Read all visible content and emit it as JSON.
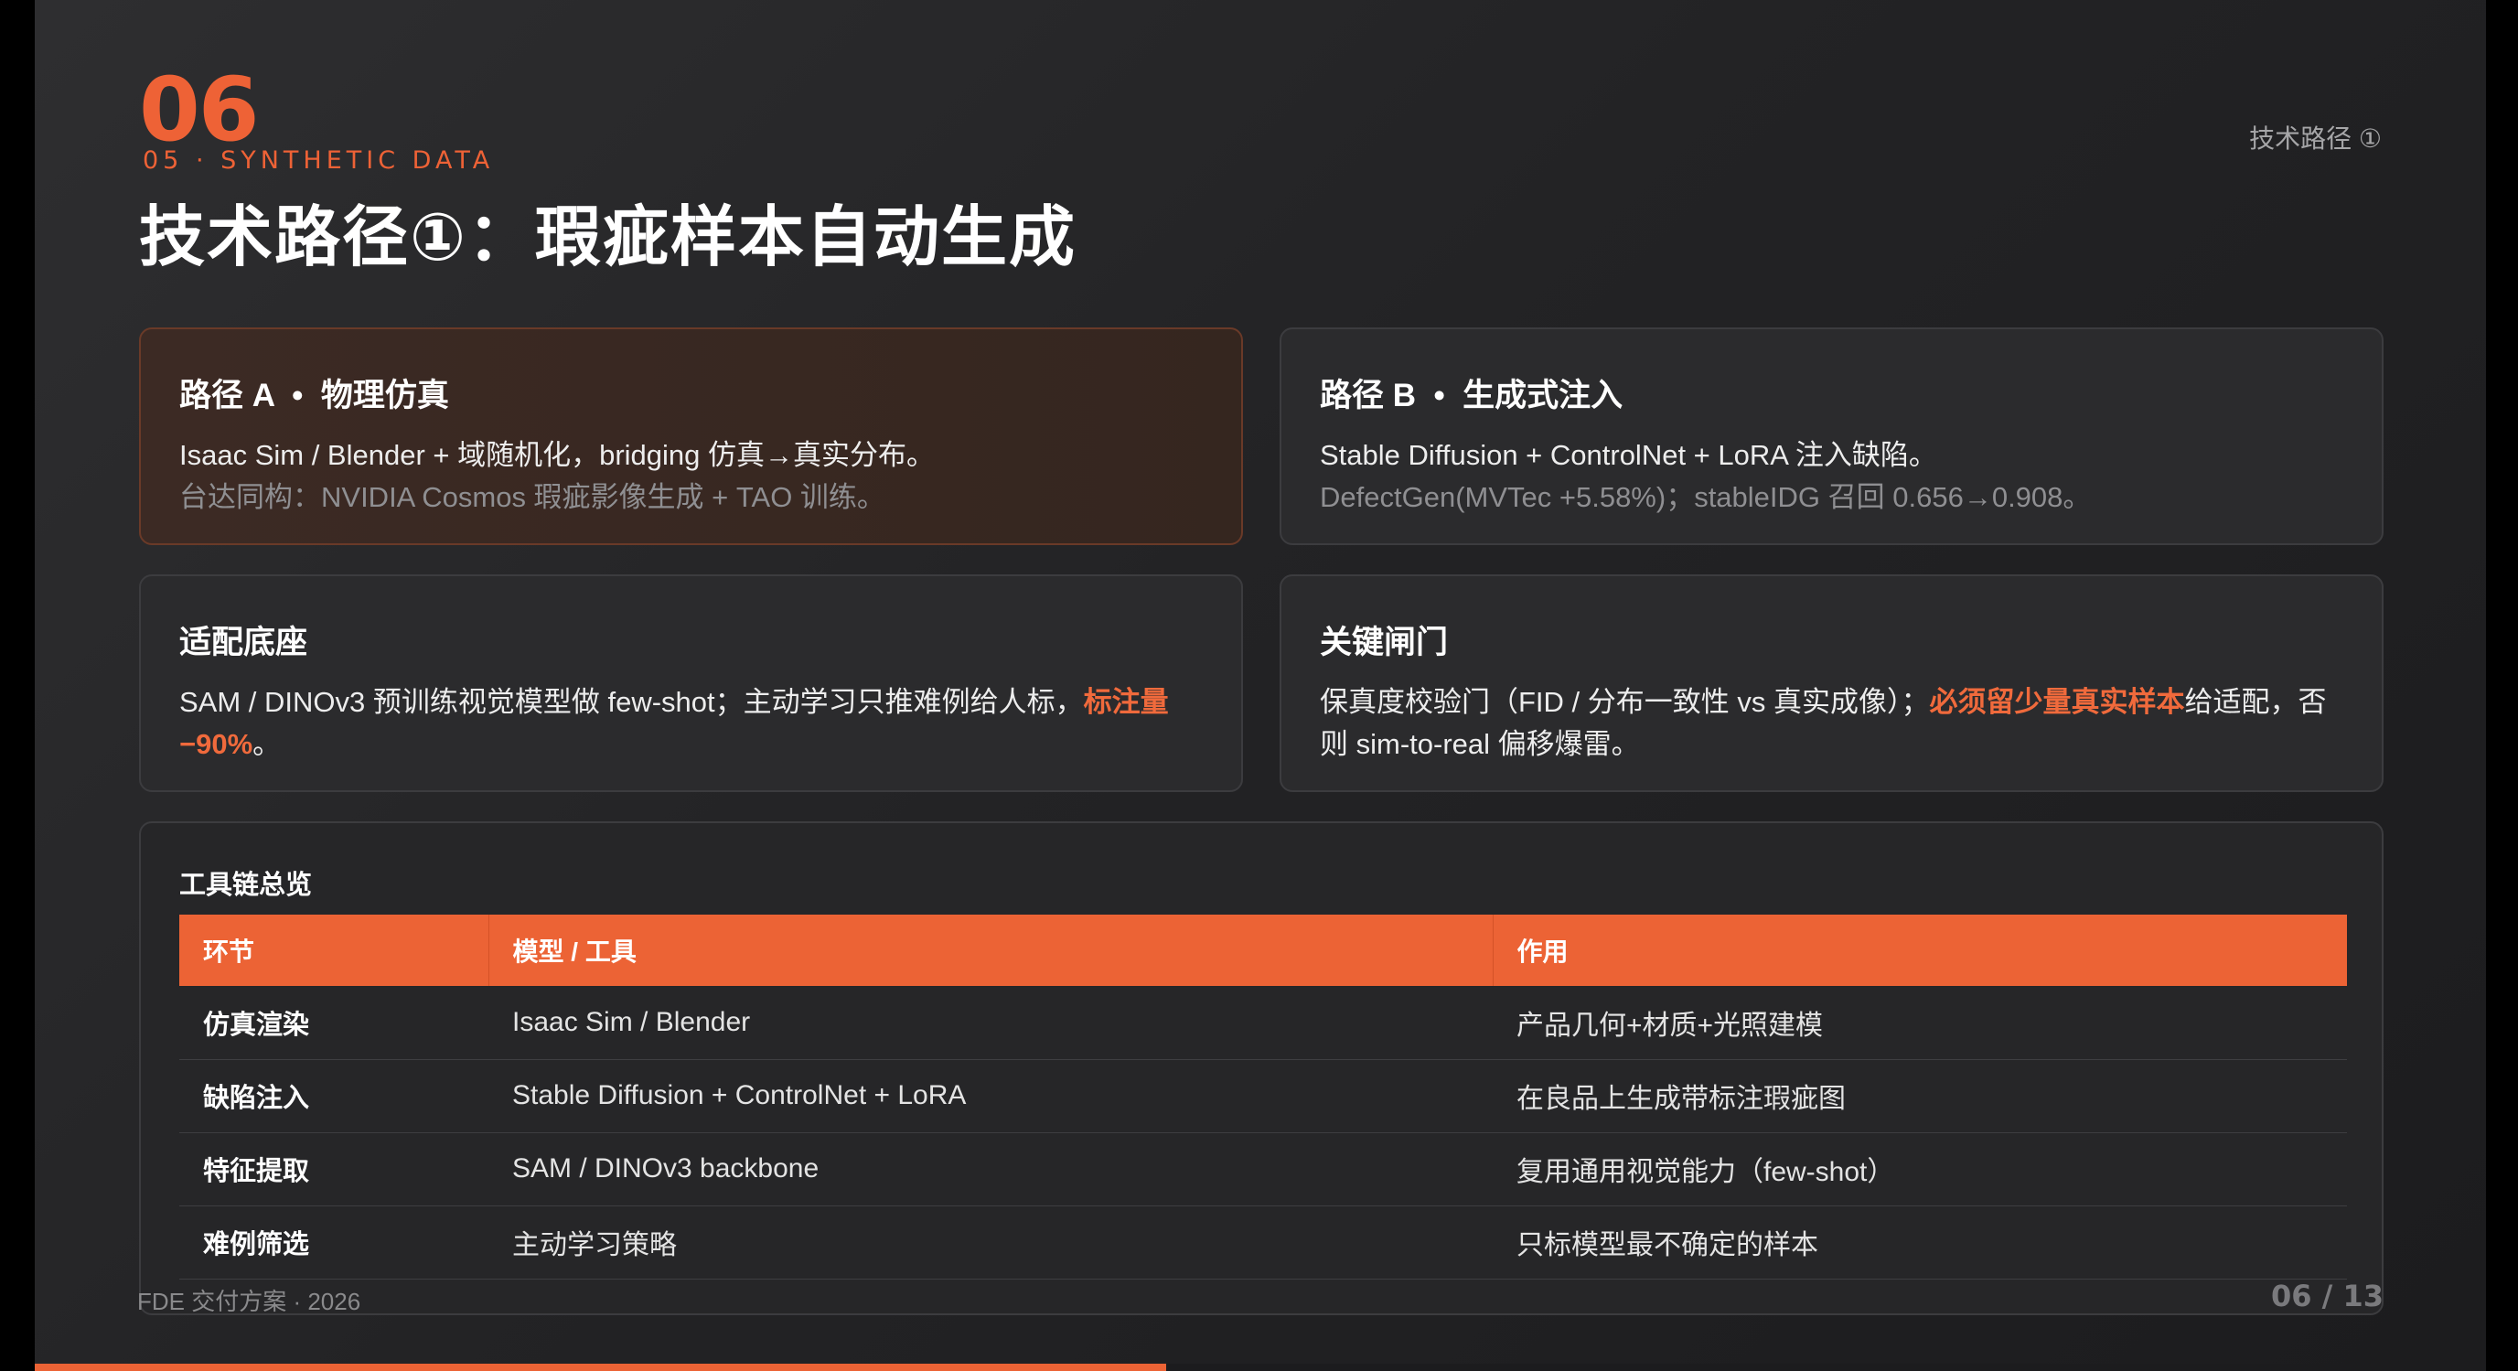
{
  "slide": {
    "number": "06",
    "section": "05 · SYNTHETIC DATA",
    "title": "技术路径①：瑕疵样本自动生成",
    "corner_tag": "技术路径 ①"
  },
  "cards": {
    "a": {
      "title": "路径 A  •  物理仿真",
      "line1": "Isaac Sim / Blender + 域随机化，bridging 仿真→真实分布。",
      "line2": "台达同构：NVIDIA Cosmos 瑕疵影像生成 + TAO 训练。"
    },
    "b": {
      "title": "路径 B  •  生成式注入",
      "line1": "Stable Diffusion + ControlNet + LoRA 注入缺陷。",
      "line2": "DefectGen(MVTec +5.58%)；stableIDG 召回 0.656→0.908。"
    },
    "c": {
      "title": "适配底座",
      "text_before": "SAM / DINOv3 预训练视觉模型做 few-shot；主动学习只推难例给人标，",
      "accent": "标注量 −90%",
      "text_after": "。"
    },
    "d": {
      "title": "关键闸门",
      "text_before": "保真度校验门（FID / 分布一致性 vs 真实成像）；",
      "accent": "必须留少量真实样本",
      "text_after": "给适配，否则 sim-to-real 偏移爆雷。"
    }
  },
  "toolchain": {
    "title": "工具链总览",
    "headers": [
      "环节",
      "模型 / 工具",
      "作用"
    ],
    "rows": [
      [
        "仿真渲染",
        "Isaac Sim / Blender",
        "产品几何+材质+光照建模"
      ],
      [
        "缺陷注入",
        "Stable Diffusion + ControlNet + LoRA",
        "在良品上生成带标注瑕疵图"
      ],
      [
        "特征提取",
        "SAM / DINOv3 backbone",
        "复用通用视觉能力（few-shot）"
      ],
      [
        "难例筛选",
        "主动学习策略",
        "只标模型最不确定的样本"
      ]
    ]
  },
  "footer": {
    "left": "FDE 交付方案 · 2026",
    "page": "06 / 13",
    "progress_fraction": 0.4615
  },
  "colors": {
    "accent": "#ec6335",
    "background": "#232325",
    "card": "#2b2b2d"
  }
}
